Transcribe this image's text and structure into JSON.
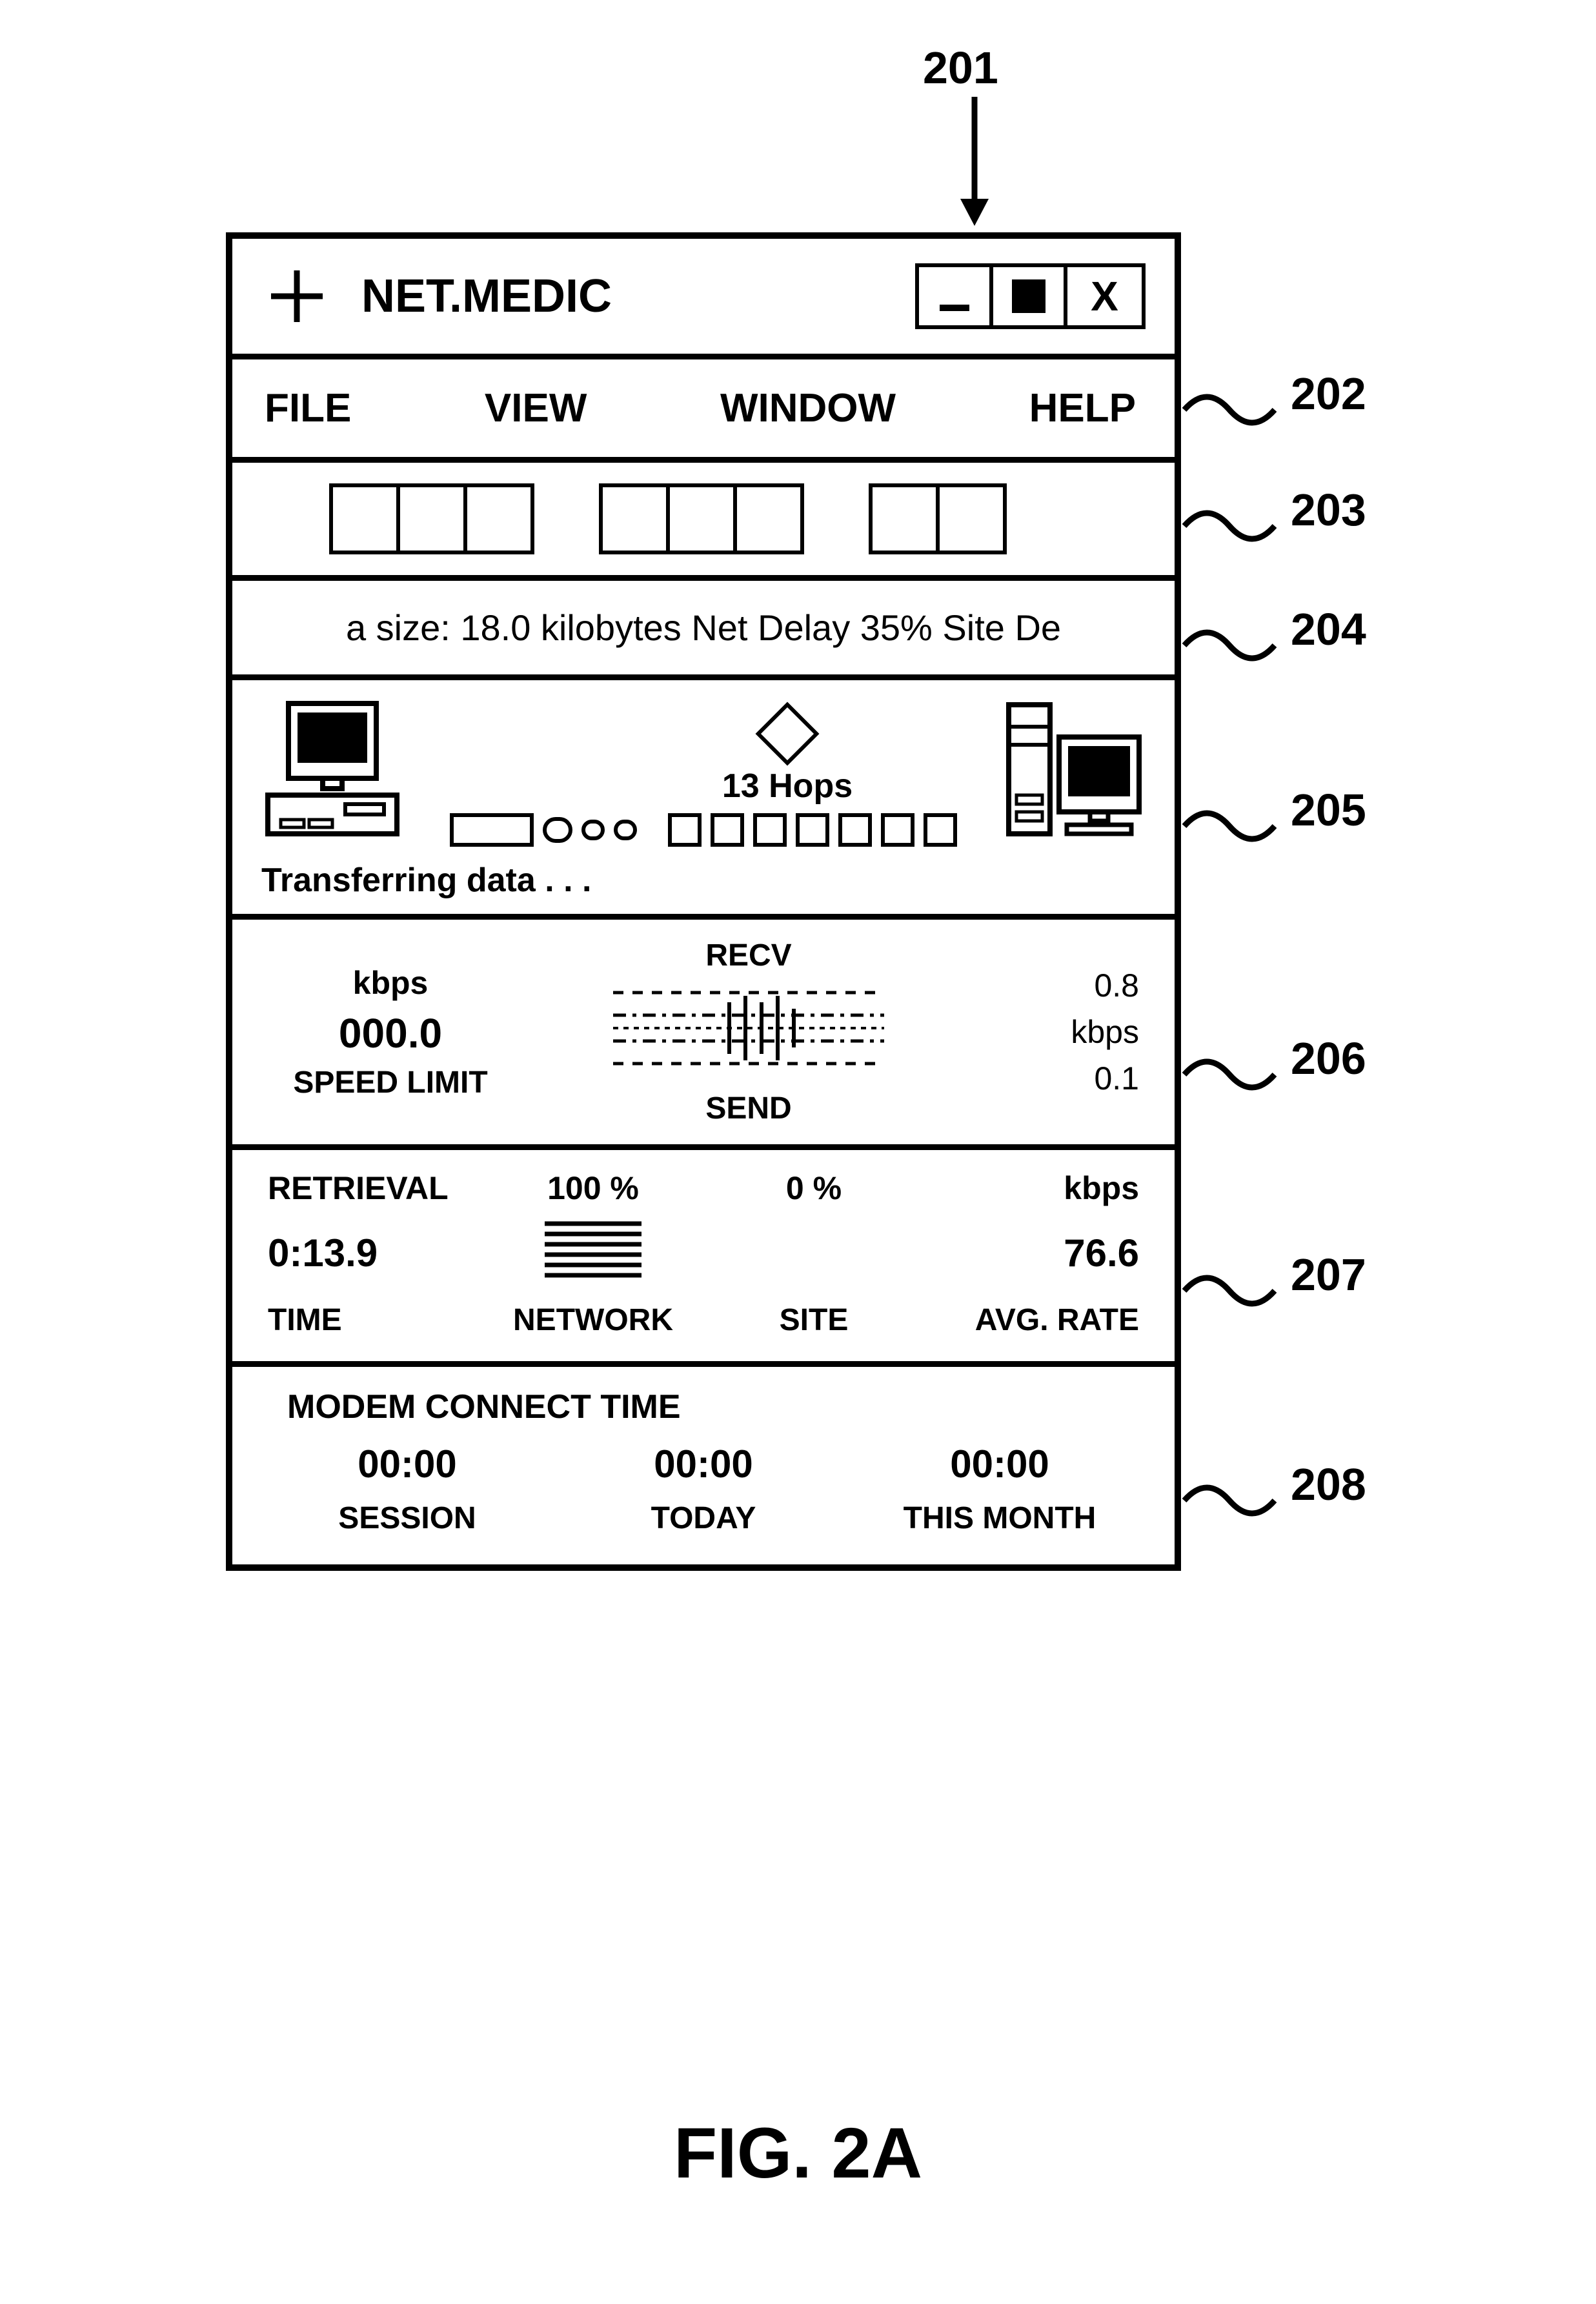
{
  "callouts": {
    "c201": "201",
    "c202": "202",
    "c203": "203",
    "c204": "204",
    "c205": "205",
    "c206": "206",
    "c207": "207",
    "c208": "208"
  },
  "figure_label": "FIG. 2A",
  "titlebar": {
    "app_title": "NET.MEDIC",
    "minimize": "_",
    "close": "X"
  },
  "menubar": {
    "file": "FILE",
    "view": "VIEW",
    "window": "WINDOW",
    "help": "HELP"
  },
  "status": {
    "text": "a size: 18.0 kilobytes Net Delay 35% Site De"
  },
  "datapane": {
    "hops_label": "13 Hops",
    "transfer_label": "Transferring data . . ."
  },
  "speedpane": {
    "left_unit": "kbps",
    "left_value": "000.0",
    "left_label": "SPEED LIMIT",
    "recv_label": "RECV",
    "send_label": "SEND",
    "right_recv": "0.8",
    "right_unit": "kbps",
    "right_send": "0.1"
  },
  "retpane": {
    "title": "RETRIEVAL",
    "percent_network": "100 %",
    "percent_site": "0 %",
    "rate_unit": "kbps",
    "time_value": "0:13.9",
    "rate_value": "76.6",
    "label_time": "TIME",
    "label_network": "NETWORK",
    "label_site": "SITE",
    "label_rate": "AVG. RATE"
  },
  "chart_data": {
    "type": "bar",
    "categories": [
      "NETWORK",
      "SITE"
    ],
    "values": [
      100,
      0
    ],
    "title": "Retrieval delay breakdown",
    "xlabel": "",
    "ylabel": "%",
    "ylim": [
      0,
      100
    ]
  },
  "modem": {
    "title": "MODEM CONNECT TIME",
    "session_value": "00:00",
    "today_value": "00:00",
    "month_value": "00:00",
    "session_label": "SESSION",
    "today_label": "TODAY",
    "month_label": "THIS MONTH"
  }
}
